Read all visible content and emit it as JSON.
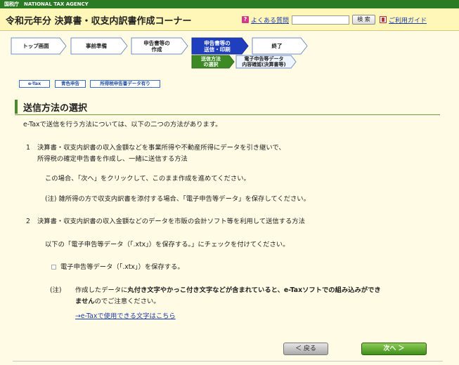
{
  "topbar": {
    "agency": "国税庁　NATIONAL TAX AGENCY"
  },
  "header": {
    "title": "令和元年分 決算書・収支内訳書作成コーナー",
    "faq_icon": "?",
    "faq_label": "よくある質問",
    "search_placeholder": "",
    "search_button": "検 索",
    "guide_label": "ご利用ガイド"
  },
  "steps": [
    {
      "label": "トップ画面",
      "state": "done"
    },
    {
      "label": "事前準備",
      "state": "done"
    },
    {
      "label": "申告書等の\n作成",
      "state": "done"
    },
    {
      "label": "申告書等の\n送信・印刷",
      "state": "current"
    },
    {
      "label": "終了",
      "state": "todo"
    }
  ],
  "substeps": [
    {
      "label": "送信方法\nの選択",
      "state": "current"
    },
    {
      "label": "電子申告等データ\n内容確認(決算書等)",
      "state": "todo"
    }
  ],
  "tags": [
    "e-Tax",
    "青色申告",
    "所得税申告書データ有り"
  ],
  "section": {
    "title": "送信方法の選択"
  },
  "content": {
    "intro": "e-Taxで送信を行う方法については、以下の二つの方法があります。",
    "item1_num": "1",
    "item1_line1": "決算書・収支内訳書の収入金額などを事業所得や不動産所得にデータを引き継いで、",
    "item1_line2": "所得税の確定申告書を作成し、一緒に送信する方法",
    "item1_note": "この場合、「次へ」をクリックして、このまま作成を進めてください。",
    "item1_caution": "(注)  雑所得の方で収支内訳書を添付する場合、「電子申告等データ」を保存してください。",
    "item2_num": "2",
    "item2_line": "決算書・収支内訳書の収入金額などのデータを市販の会計ソフト等を利用して送信する方法",
    "item2_note": "以下の「電子申告等データ（「.xtx」）を保存する。」にチェックを付けてください。",
    "checkbox_label": "電子申告等データ（「.xtx」）を保存する。",
    "caution_mark": "(注)",
    "caution_part1": "作成したデータに",
    "caution_bold1": "丸付き文字やかっこ付き文字などが含まれていると、e-Taxソフトでの組み込みができ",
    "caution_bold2": "ません",
    "caution_part2": "のでご注意ください。",
    "caution_link": "→e-Taxで使用できる文字はこちら"
  },
  "footer": {
    "back_label": "＜ 戻る",
    "next_label": "次へ ＞"
  },
  "colors": {
    "done": "#ffffff",
    "current": "#1f3fbf",
    "sub_current": "#3d8a25",
    "todo": "#ffffff"
  }
}
